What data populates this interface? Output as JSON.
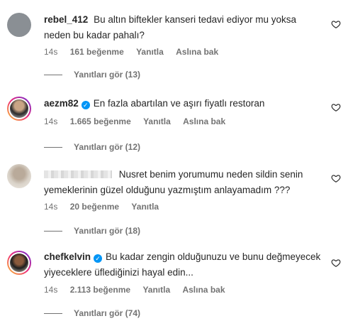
{
  "comments": [
    {
      "username": "rebel_412",
      "verified": false,
      "text": "Bu altın biftekler kanseri tedavi ediyor mu yoksa neden bu kadar pahalı?",
      "time": "14s",
      "likes": "161 beğenme",
      "reply": "Yanıtla",
      "translate": "Aslına bak",
      "view_replies": "Yanıtları gör (13)"
    },
    {
      "username": "aezm82",
      "verified": true,
      "text": "En fazla abartılan ve aşırı fiyatlı restoran",
      "time": "14s",
      "likes": "1.665 beğenme",
      "reply": "Yanıtla",
      "translate": "Aslına bak",
      "view_replies": "Yanıtları gör (12)"
    },
    {
      "username": "",
      "verified": false,
      "text": "Nusret benim yorumumu neden sildin senin yemeklerinin güzel olduğunu yazmıştım anlayamadım ???",
      "time": "14s",
      "likes": "20 beğenme",
      "reply": "Yanıtla",
      "translate": "",
      "view_replies": "Yanıtları gör (18)"
    },
    {
      "username": "chefkelvin",
      "verified": true,
      "text": "Bu kadar zengin olduğunuzu ve bunu değmeyecek yiyeceklere üflediğinizi hayal edin...",
      "time": "14s",
      "likes": "2.113 beğenme",
      "reply": "Yanıtla",
      "translate": "Aslına bak",
      "view_replies": "Yanıtları gör (74)"
    }
  ],
  "colors": {
    "text": "#262626",
    "secondary": "#737373",
    "verified": "#0095f6"
  },
  "icons": {
    "like": "heart-outline-icon",
    "verified": "verified-check-icon"
  }
}
